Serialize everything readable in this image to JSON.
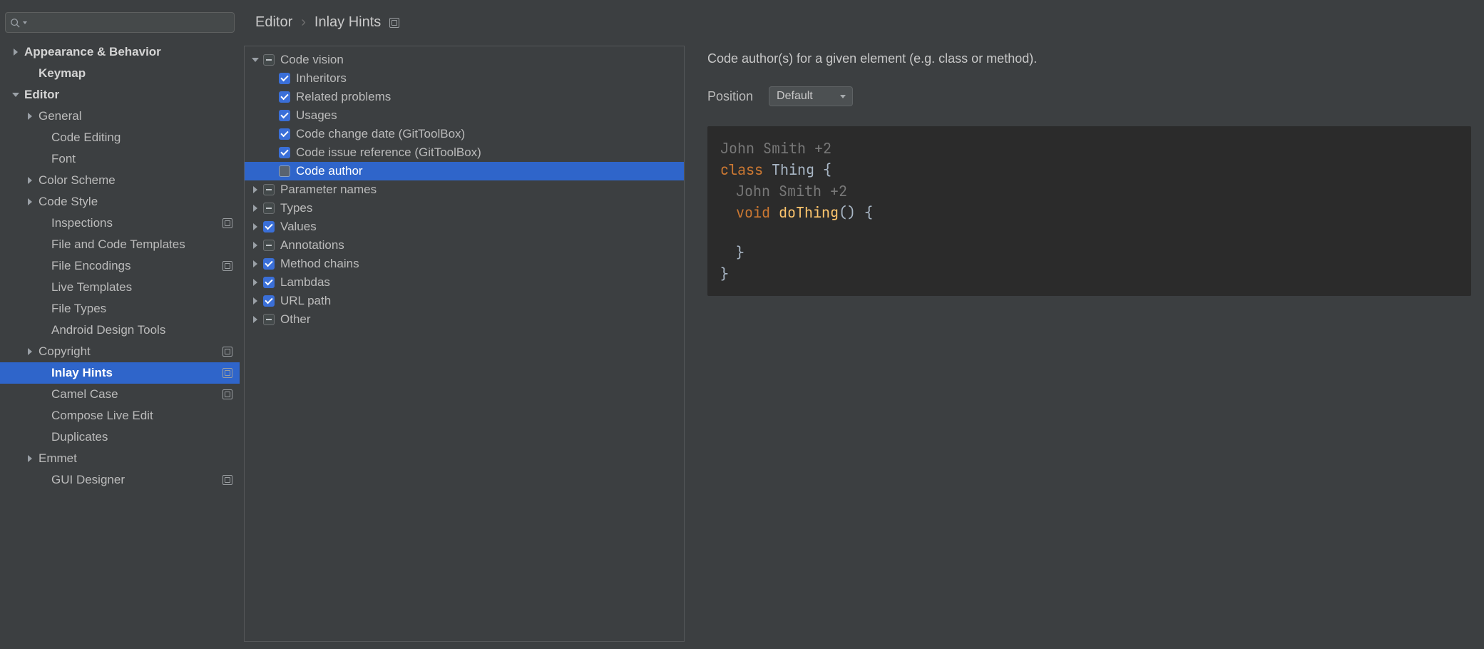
{
  "search": {
    "placeholder": ""
  },
  "breadcrumb": {
    "a": "Editor",
    "b": "Inlay Hints"
  },
  "sidebar": [
    {
      "label": "Appearance & Behavior",
      "indent": 0,
      "arrow": "collapsed",
      "bold": true
    },
    {
      "label": "Keymap",
      "indent": 1,
      "arrow": "none",
      "bold": true
    },
    {
      "label": "Editor",
      "indent": 0,
      "arrow": "expanded",
      "bold": true
    },
    {
      "label": "General",
      "indent": 1,
      "arrow": "collapsed"
    },
    {
      "label": "Code Editing",
      "indent": 2,
      "arrow": "none"
    },
    {
      "label": "Font",
      "indent": 2,
      "arrow": "none"
    },
    {
      "label": "Color Scheme",
      "indent": 1,
      "arrow": "collapsed"
    },
    {
      "label": "Code Style",
      "indent": 1,
      "arrow": "collapsed"
    },
    {
      "label": "Inspections",
      "indent": 2,
      "arrow": "none",
      "proj": true
    },
    {
      "label": "File and Code Templates",
      "indent": 2,
      "arrow": "none"
    },
    {
      "label": "File Encodings",
      "indent": 2,
      "arrow": "none",
      "proj": true
    },
    {
      "label": "Live Templates",
      "indent": 2,
      "arrow": "none"
    },
    {
      "label": "File Types",
      "indent": 2,
      "arrow": "none"
    },
    {
      "label": "Android Design Tools",
      "indent": 2,
      "arrow": "none"
    },
    {
      "label": "Copyright",
      "indent": 1,
      "arrow": "collapsed",
      "proj": true
    },
    {
      "label": "Inlay Hints",
      "indent": 2,
      "arrow": "none",
      "bold": true,
      "selected": true,
      "proj": true
    },
    {
      "label": "Camel Case",
      "indent": 2,
      "arrow": "none",
      "proj": true
    },
    {
      "label": "Compose Live Edit",
      "indent": 2,
      "arrow": "none"
    },
    {
      "label": "Duplicates",
      "indent": 2,
      "arrow": "none"
    },
    {
      "label": "Emmet",
      "indent": 1,
      "arrow": "collapsed"
    },
    {
      "label": "GUI Designer",
      "indent": 2,
      "arrow": "none",
      "proj": true
    }
  ],
  "categories": [
    {
      "label": "Code vision",
      "indent": 0,
      "arrow": "expanded",
      "cb": "minus"
    },
    {
      "label": "Inheritors",
      "indent": 1,
      "arrow": "none",
      "cb": "checked"
    },
    {
      "label": "Related problems",
      "indent": 1,
      "arrow": "none",
      "cb": "checked"
    },
    {
      "label": "Usages",
      "indent": 1,
      "arrow": "none",
      "cb": "checked"
    },
    {
      "label": "Code change date (GitToolBox)",
      "indent": 1,
      "arrow": "none",
      "cb": "checked"
    },
    {
      "label": "Code issue reference (GitToolBox)",
      "indent": 1,
      "arrow": "none",
      "cb": "checked"
    },
    {
      "label": "Code author",
      "indent": 1,
      "arrow": "none",
      "cb": "empty",
      "selected": true
    },
    {
      "label": "Parameter names",
      "indent": 0,
      "arrow": "collapsed",
      "cb": "minus"
    },
    {
      "label": "Types",
      "indent": 0,
      "arrow": "collapsed",
      "cb": "minus"
    },
    {
      "label": "Values",
      "indent": 0,
      "arrow": "collapsed",
      "cb": "checked"
    },
    {
      "label": "Annotations",
      "indent": 0,
      "arrow": "collapsed",
      "cb": "minus"
    },
    {
      "label": "Method chains",
      "indent": 0,
      "arrow": "collapsed",
      "cb": "checked"
    },
    {
      "label": "Lambdas",
      "indent": 0,
      "arrow": "collapsed",
      "cb": "checked"
    },
    {
      "label": "URL path",
      "indent": 0,
      "arrow": "collapsed",
      "cb": "checked"
    },
    {
      "label": "Other",
      "indent": 0,
      "arrow": "collapsed",
      "cb": "minus"
    }
  ],
  "detail": {
    "desc": "Code author(s) for a given element (e.g. class or method).",
    "pos_label": "Position",
    "pos_value": "Default",
    "code": {
      "hint1": "John Smith +2",
      "kw_class": "class",
      "cls": " Thing {",
      "hint2": "John Smith +2",
      "kw_void": "void",
      "method": " doThing",
      "suffix": "() {",
      "brace": "}",
      "brace2": "}"
    }
  }
}
